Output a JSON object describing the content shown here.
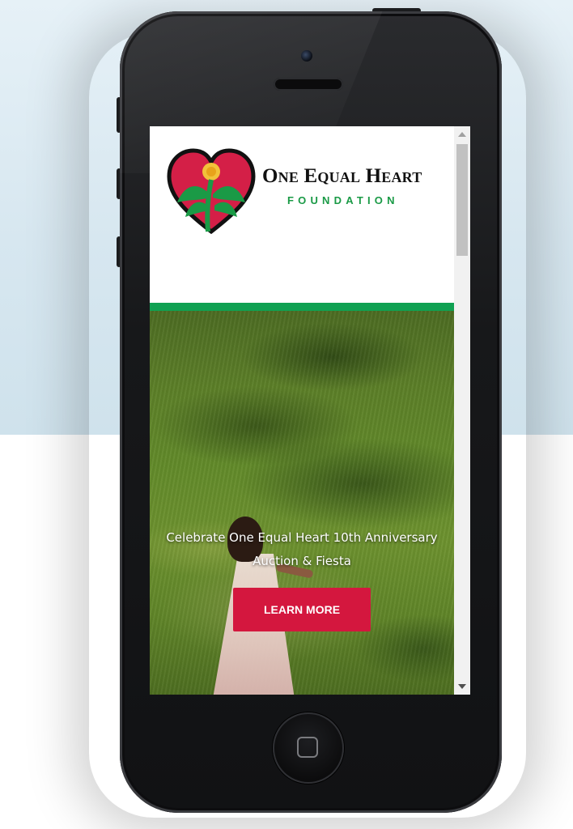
{
  "brand": {
    "name": "One Equal Heart",
    "subtitle": "FOUNDATION"
  },
  "hero": {
    "title_line1": "Celebrate One Equal Heart 10th Anniversary",
    "title_line2": "Auction & Fiesta",
    "cta_label": "LEARN MORE"
  },
  "colors": {
    "brand_green": "#10a152",
    "cta_red": "#d4173e",
    "heart_red": "#d41f47"
  },
  "icons": {
    "logo": "heart-plant-logo-icon",
    "home": "home-button-icon",
    "scroll_up": "scroll-up-arrow-icon",
    "scroll_down": "scroll-down-arrow-icon"
  }
}
